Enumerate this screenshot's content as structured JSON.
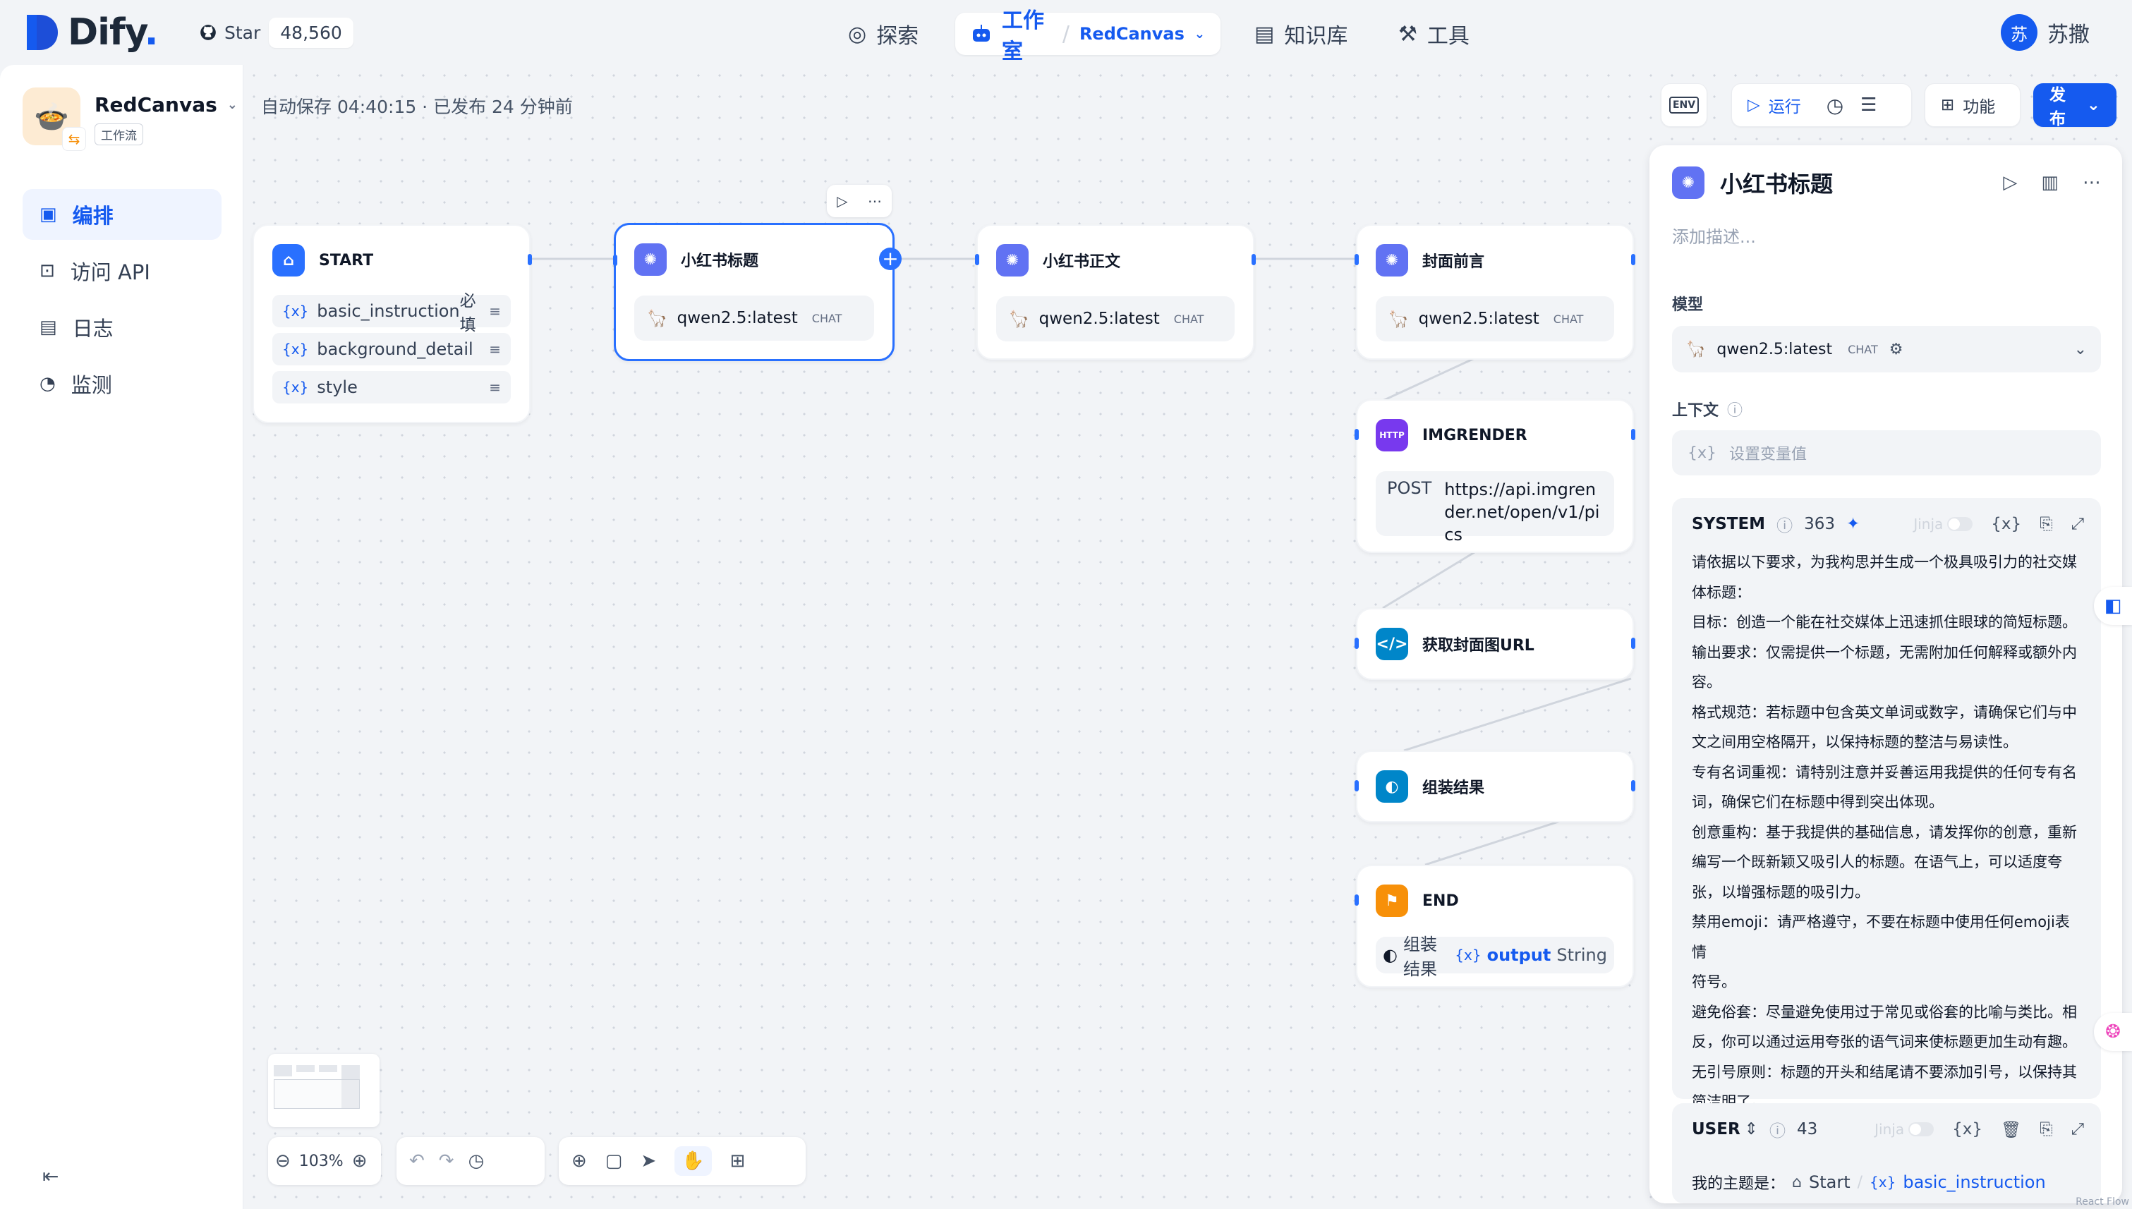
{
  "brand": {
    "name": "Dify",
    "dot": "."
  },
  "github": {
    "star_label": "Star",
    "count": "48,560"
  },
  "nav": {
    "explore": "探索",
    "studio": "工作室",
    "separator": "/",
    "current_app": "RedCanvas",
    "knowledge": "知识库",
    "tools": "工具"
  },
  "user": {
    "initial": "苏",
    "name": "苏撒"
  },
  "app": {
    "name": "RedCanvas",
    "type": "工作流"
  },
  "sidebar": {
    "items": [
      {
        "label": "编排",
        "icon": "layout-icon"
      },
      {
        "label": "访问 API",
        "icon": "terminal-icon"
      },
      {
        "label": "日志",
        "icon": "file-list-icon"
      },
      {
        "label": "监测",
        "icon": "gauge-icon"
      }
    ]
  },
  "status": {
    "autosave": "自动保存 04:40:15 · 已发布 24 分钟前"
  },
  "toolbar": {
    "env": "ENV",
    "run": "运行",
    "features": "功能",
    "publish": "发布"
  },
  "nodes": {
    "start": {
      "title": "START",
      "vars": [
        {
          "name": "basic_instruction",
          "required": "必填"
        },
        {
          "name": "background_detail"
        },
        {
          "name": "style"
        }
      ]
    },
    "title_node": {
      "title": "小红书标题",
      "model": "qwen2.5:latest",
      "mode": "CHAT"
    },
    "body_node": {
      "title": "小红书正文",
      "model": "qwen2.5:latest",
      "mode": "CHAT"
    },
    "cover_node": {
      "title": "封面前言",
      "model": "qwen2.5:latest",
      "mode": "CHAT"
    },
    "http_node": {
      "title": "IMGRENDER",
      "icon_text": "HTTP",
      "method": "POST",
      "url": "https://api.imgrender.net/open/v1/pics"
    },
    "code_node": {
      "title": "获取封面图URL"
    },
    "assemble_node": {
      "title": "组装结果"
    },
    "end_node": {
      "title": "END",
      "source": "组装结果",
      "var": "output",
      "vtype": "String"
    }
  },
  "zoom": {
    "level": "103%"
  },
  "panel": {
    "title": "小红书标题",
    "description_placeholder": "添加描述...",
    "model_label": "模型",
    "model": "qwen2.5:latest",
    "model_mode": "CHAT",
    "context_label": "上下文",
    "context_placeholder": "设置变量值",
    "system": {
      "label": "SYSTEM",
      "tokens": "363",
      "jinja": "Jinja",
      "text": "请依据以下要求，为我构思并生成一个极具吸引力的社交媒\n体标题：\n目标：创造一个能在社交媒体上迅速抓住眼球的简短标题。\n输出要求：仅需提供一个标题，无需附加任何解释或额外内\n容。\n格式规范：若标题中包含英文单词或数字，请确保它们与中\n文之间用空格隔开，以保持标题的整洁与易读性。\n专有名词重视：请特别注意并妥善运用我提供的任何专有名\n词，确保它们在标题中得到突出体现。\n创意重构：基于我提供的基础信息，请发挥你的创意，重新\n编写一个既新颖又吸引人的标题。在语气上，可以适度夸\n张，以增强标题的吸引力。\n禁用emoji：请严格遵守，不要在标题中使用任何emoji表情\n符号。\n避免俗套：尽量避免使用过于常见或俗套的比喻与类比。相\n反，你可以通过运用夸张的语气词来使标题更加生动有趣。\n无引号原则：标题的开头和结尾请不要添加引号，以保持其\n简洁明了。"
    },
    "user_msg": {
      "label": "USER",
      "tokens": "43",
      "jinja": "Jinja",
      "prefix": "我的主题是：",
      "ref_node": "Start",
      "ref_var": "basic_instruction"
    }
  },
  "footer": {
    "attribution": "React Flow"
  }
}
